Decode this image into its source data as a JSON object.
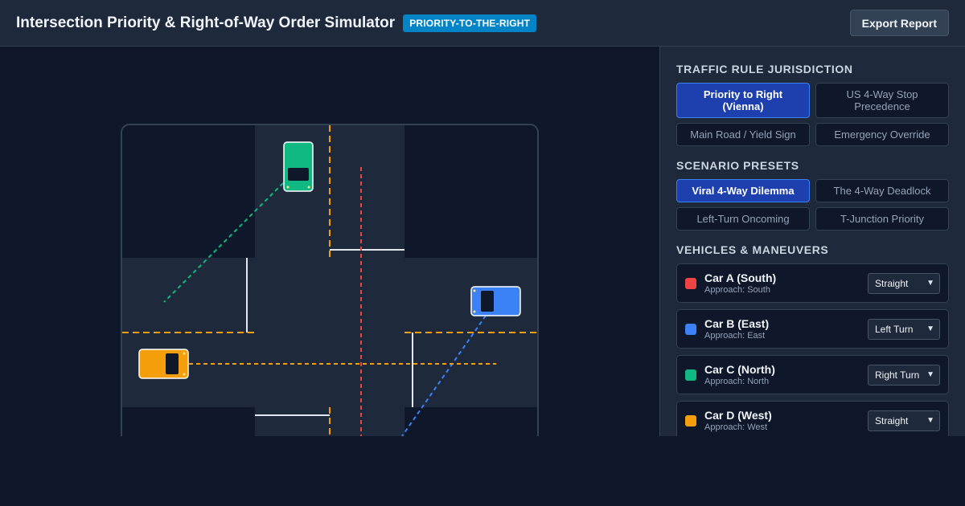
{
  "header": {
    "title": "Intersection Priority & Right-of-Way Order Simulator",
    "badge": "PRIORITY-TO-THE-RIGHT",
    "export_label": "Export Report"
  },
  "jurisdiction": {
    "title": "TRAFFIC RULE JURISDICTION",
    "options": [
      "Priority to Right (Vienna)",
      "US 4-Way Stop Precedence",
      "Main Road / Yield Sign",
      "Emergency Override"
    ],
    "selected": "Priority to Right (Vienna)"
  },
  "presets": {
    "title": "SCENARIO PRESETS",
    "options": [
      "Viral 4-Way Dilemma",
      "The 4-Way Deadlock",
      "Left-Turn Oncoming",
      "T-Junction Priority"
    ],
    "selected": "Viral 4-Way Dilemma"
  },
  "vehicles": {
    "title": "VEHICLES & MANEUVERS",
    "items": [
      {
        "name": "Car A (South)",
        "approach": "Approach: South",
        "maneuver": "Straight",
        "color": "#ef4444"
      },
      {
        "name": "Car B (East)",
        "approach": "Approach: East",
        "maneuver": "Left Turn",
        "color": "#3b82f6"
      },
      {
        "name": "Car C (North)",
        "approach": "Approach: North",
        "maneuver": "Right Turn",
        "color": "#10b981"
      },
      {
        "name": "Car D (West)",
        "approach": "Approach: West",
        "maneuver": "Straight",
        "color": "#f59e0b"
      }
    ]
  },
  "colors": {
    "road": "#1e293b",
    "background": "#0f172a",
    "lane_divider": "#f59e0b",
    "stop_line": "#e2e8f0"
  }
}
